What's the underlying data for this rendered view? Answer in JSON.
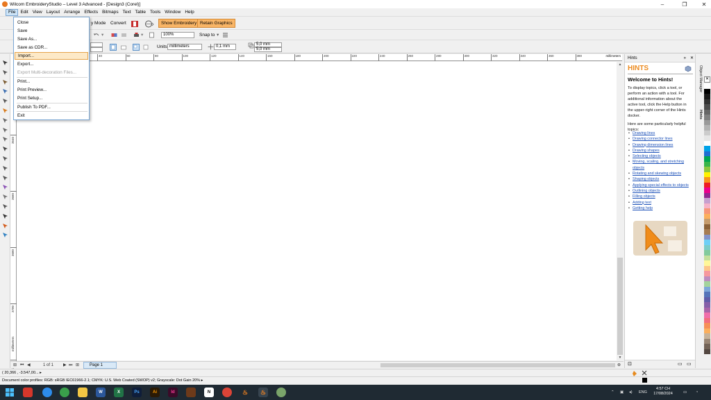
{
  "window": {
    "title": "Wilcom EmbroideryStudio – Level 3 Advanced - [Design3 (Corel)]",
    "minimize": "–",
    "restore": "❐",
    "close": "✕"
  },
  "menubar": [
    "File",
    "Edit",
    "View",
    "Layout",
    "Arrange",
    "Effects",
    "Bitmaps",
    "Text",
    "Table",
    "Tools",
    "Window",
    "Help"
  ],
  "file_menu": {
    "items": [
      {
        "label": "Close",
        "state": "normal"
      },
      {
        "label": "Save",
        "state": "normal"
      },
      {
        "label": "Save As...",
        "state": "normal"
      },
      {
        "label": "Save as CDR...",
        "state": "normal"
      },
      {
        "label": "Import...",
        "state": "highlighted"
      },
      {
        "label": "Export...",
        "state": "normal"
      },
      {
        "label": "Export Multi-decoration Files...",
        "state": "disabled"
      },
      {
        "label": "Print...",
        "state": "normal"
      },
      {
        "label": "Print Preview...",
        "state": "normal"
      },
      {
        "label": "Print Setup...",
        "state": "normal"
      },
      {
        "label": "Publish To PDF...",
        "state": "normal"
      },
      {
        "label": "Exit",
        "state": "normal"
      }
    ]
  },
  "toolbar": {
    "mode_label": "y Mode",
    "convert_label": "Convert",
    "show_embroidery_label": "Show Embroidery",
    "retain_graphics_label": "Retain Graphics",
    "zoom_value": "100%",
    "snap_to_label": "Snap to",
    "units_label": "Units:",
    "units_value": "millimeters",
    "nudge_value": "0,1 mm",
    "dup_x": "5,0 mm",
    "dup_y": "5,0 mm"
  },
  "ruler": {
    "h_ticks": [
      "40",
      "60",
      "80",
      "100",
      "120",
      "140",
      "160",
      "180",
      "200",
      "220",
      "240",
      "260",
      "280",
      "300",
      "320",
      "340",
      "360",
      "380"
    ],
    "h_unit": "millimeters",
    "v_ticks": [
      "3640",
      "3660",
      "3680",
      "3700",
      "3720"
    ],
    "v_unit": "millimeters"
  },
  "navbar": {
    "page_count": "1 of 1",
    "page_tab": "Page 1"
  },
  "status": {
    "coords": "( 20,366 , -3.547,00... ▸",
    "color_profiles": "Document color profiles: RGB: sRGB IEC61966-2.1; CMYK: U.S. Web Coated (SWOP) v2; Grayscale: Dot Gain 20% ▸"
  },
  "hints": {
    "docker_title": "Hints",
    "big_title": "HINTS",
    "welcome": "Welcome to Hints!",
    "intro": "To display topics, click a tool, or perform an action with a tool. For additional information about the active tool, click the Help button in the upper-right corner of the Hints docker.",
    "helpful": "Here are some particularly helpful topics:",
    "links": [
      "Drawing lines",
      "Drawing connector lines",
      "Drawing dimension lines",
      "Drawing shapes",
      "Selecting objects",
      "Moving, scaling, and stretching objects",
      "Rotating and skewing objects",
      "Shaping objects",
      "Applying special effects to objects",
      "Outlining objects",
      "Filling objects",
      "Adding text",
      "Getting help"
    ]
  },
  "side_tabs": [
    "Object Manager",
    "Hints"
  ],
  "palette_colors": [
    "#ffffff",
    "#000000",
    "#1a1a1a",
    "#333333",
    "#4d4d4d",
    "#666666",
    "#808080",
    "#999999",
    "#b3b3b3",
    "#cccccc",
    "#e6e6e6",
    "#ffffff",
    "#00a2e8",
    "#1f6fd1",
    "#00a651",
    "#39b54a",
    "#8dc63f",
    "#fff200",
    "#f7941d",
    "#ed1c24",
    "#ec008c",
    "#92278f",
    "#c7a0cf",
    "#f5b2c8",
    "#f69679",
    "#fbaf5d",
    "#c69c6d",
    "#8c6239",
    "#a67c52",
    "#8393ca",
    "#6dcff6",
    "#7accc8",
    "#82ca9c",
    "#c4df9b",
    "#fff799",
    "#fdc68a",
    "#f6989d",
    "#bd8cbf",
    "#a3d39c",
    "#7da7d9",
    "#5574b9",
    "#605ca8",
    "#855fa8",
    "#a864a8",
    "#f06eaa",
    "#f26d7d",
    "#f68e56",
    "#fbaf5d",
    "#c7b299",
    "#998675",
    "#736357",
    "#534741"
  ],
  "taskbar": {
    "language": "ENG",
    "time": "4:57 CH",
    "date": "17/08/2024"
  }
}
